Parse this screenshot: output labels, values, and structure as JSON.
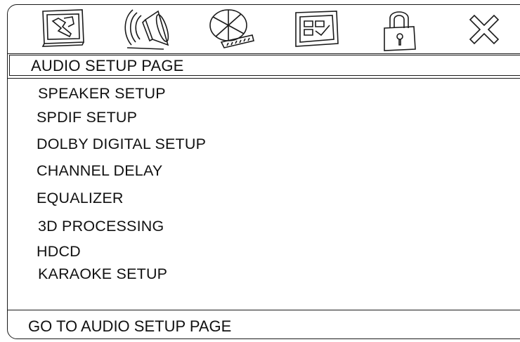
{
  "toolbar": {
    "icons": [
      "general-setup-icon",
      "audio-setup-icon",
      "video-setup-icon",
      "preference-icon",
      "password-lock-icon",
      "exit-icon"
    ]
  },
  "page": {
    "title": "AUDIO SETUP PAGE"
  },
  "menu": {
    "items": [
      {
        "label": "SPEAKER SETUP"
      },
      {
        "label": "SPDIF SETUP"
      },
      {
        "label": "DOLBY DIGITAL SETUP"
      },
      {
        "label": "CHANNEL DELAY"
      },
      {
        "label": "EQUALIZER"
      },
      {
        "label": "3D PROCESSING"
      },
      {
        "label": "HDCD"
      },
      {
        "label": "KARAOKE SETUP"
      }
    ]
  },
  "status": {
    "text": "GO TO AUDIO SETUP PAGE"
  }
}
